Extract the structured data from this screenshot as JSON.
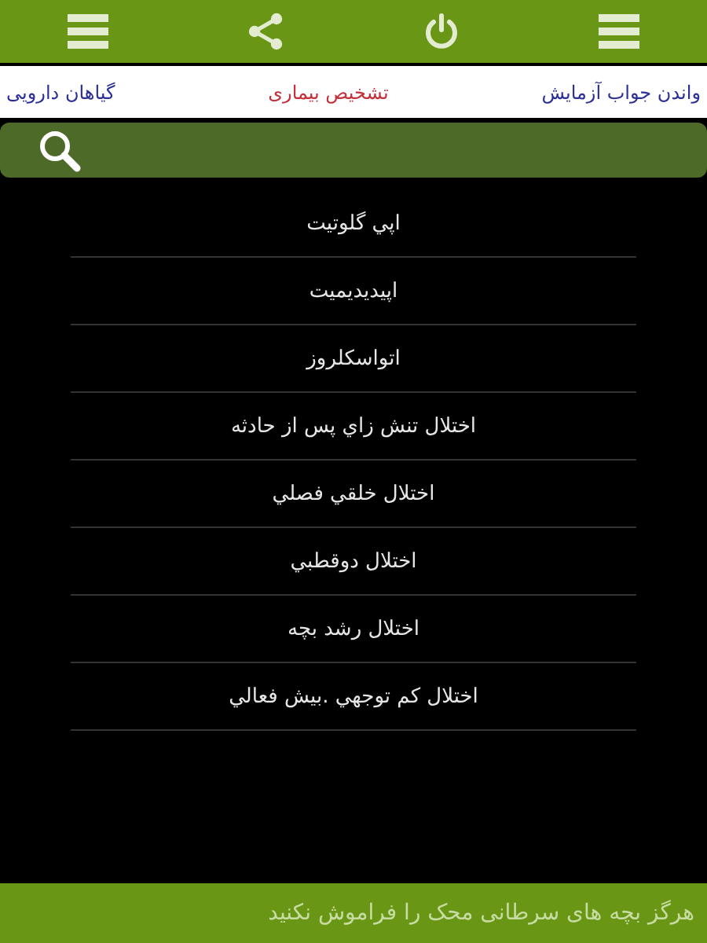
{
  "toolbar": {
    "buttons": [
      {
        "kind": "menu"
      },
      {
        "kind": "share"
      },
      {
        "kind": "power"
      },
      {
        "kind": "menu"
      }
    ]
  },
  "tabs": [
    {
      "label": "واندن جواب آزمایش",
      "selected": false
    },
    {
      "label": "تشخیص بیماری",
      "selected": true
    },
    {
      "label": "گیاهان دارویی",
      "selected": false
    }
  ],
  "search": {
    "kind": "search"
  },
  "list": {
    "items": [
      "اپي گلوتيت",
      "اپيدیديميت",
      "اتواسكلروز",
      "اختلال تنش زاي پس از حادثه",
      "اختلال خلقي فصلي",
      "اختلال دوقطبي",
      "اختلال رشد بچه",
      "اختلال كم توجهي .بيش فعالي"
    ]
  },
  "ticker": {
    "text": "هرگز بچه های سرطانی محک را فراموش نکنید"
  }
}
